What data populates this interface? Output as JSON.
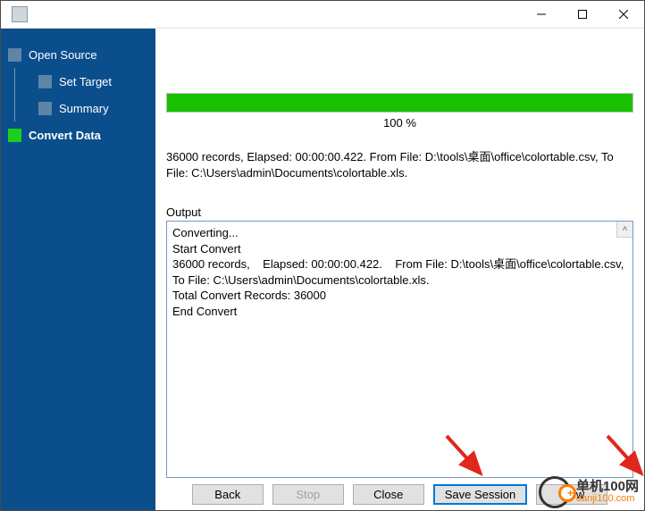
{
  "sidebar": {
    "items": [
      {
        "label": "Open Source",
        "active": false,
        "child": false
      },
      {
        "label": "Set Target",
        "active": false,
        "child": true
      },
      {
        "label": "Summary",
        "active": false,
        "child": true
      },
      {
        "label": "Convert Data",
        "active": true,
        "child": false
      }
    ]
  },
  "progress": {
    "percent_label": "100 %",
    "fill_percent": 100
  },
  "summary_text": "36000 records,    Elapsed: 00:00:00.422.    From File: D:\\tools\\桌面\\office\\colortable.csv,    To File: C:\\Users\\admin\\Documents\\colortable.xls.",
  "output": {
    "label": "Output",
    "lines": [
      "Converting...",
      "Start Convert",
      "36000 records,    Elapsed: 00:00:00.422.    From File: D:\\tools\\桌面\\office\\colortable.csv,    To File: C:\\Users\\admin\\Documents\\colortable.xls.",
      "Total Convert Records: 36000",
      "End Convert"
    ]
  },
  "buttons": {
    "back": "Back",
    "stop": "Stop",
    "close": "Close",
    "save": "Save Session",
    "view": "View"
  },
  "watermark": {
    "cn": "单机100网",
    "url": "danji100.com"
  }
}
